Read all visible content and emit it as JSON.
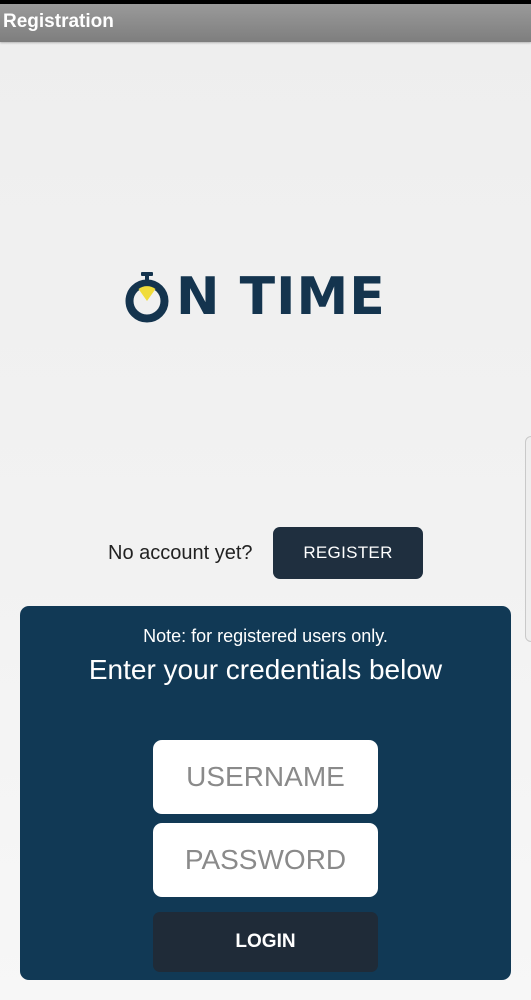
{
  "window": {
    "title": "Registration"
  },
  "logo": {
    "text_rest": "N TIME",
    "brand_color": "#14344e",
    "accent_color": "#f0dc3a"
  },
  "account": {
    "prompt": "No account yet?",
    "register_label": "REGISTER"
  },
  "login_panel": {
    "note": "Note: for registered users only.",
    "heading": "Enter your credentials below",
    "username_placeholder": "USERNAME",
    "password_placeholder": "PASSWORD",
    "login_label": "LOGIN",
    "panel_color": "#113955"
  },
  "icons": {
    "logo_o": "stopwatch-icon"
  }
}
